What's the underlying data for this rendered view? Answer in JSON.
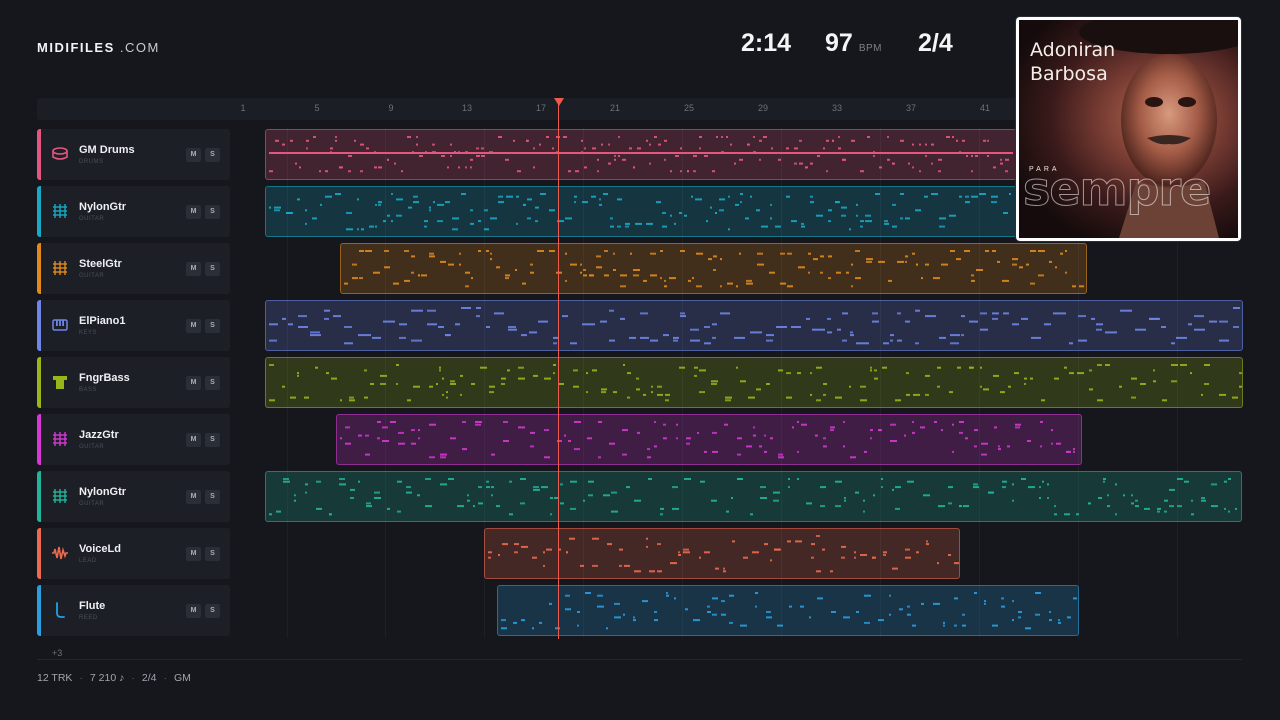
{
  "header": {
    "logo_bold": "MIDIFILES",
    "logo_suffix": " .COM",
    "time": "2:14",
    "bpm_value": "97",
    "bpm_label": "BPM",
    "time_signature": "2/4"
  },
  "ruler": {
    "ticks": [
      "1",
      "5",
      "9",
      "13",
      "17",
      "21",
      "25",
      "29",
      "33",
      "37",
      "41"
    ]
  },
  "tracks": [
    {
      "name": "GM Drums",
      "sub": "DRUMS",
      "color": "#e4567f",
      "icon": "drum-icon",
      "mute": "M",
      "solo": "S"
    },
    {
      "name": "NylonGtr",
      "sub": "GUITAR",
      "color": "#19a9c4",
      "icon": "guitar-grid-icon",
      "mute": "M",
      "solo": "S"
    },
    {
      "name": "SteelGtr",
      "sub": "GUITAR",
      "color": "#e08a1e",
      "icon": "guitar-grid-icon",
      "mute": "M",
      "solo": "S"
    },
    {
      "name": "ElPiano1",
      "sub": "KEYS",
      "color": "#6f86e8",
      "icon": "keys-icon",
      "mute": "M",
      "solo": "S"
    },
    {
      "name": "FngrBass",
      "sub": "BASS",
      "color": "#98b51a",
      "icon": "bass-icon",
      "mute": "M",
      "solo": "S"
    },
    {
      "name": "JazzGtr",
      "sub": "GUITAR",
      "color": "#d638d4",
      "icon": "guitar-grid-icon",
      "mute": "M",
      "solo": "S"
    },
    {
      "name": "NylonGtr",
      "sub": "GUITAR",
      "color": "#22b59b",
      "icon": "guitar-grid-icon",
      "mute": "M",
      "solo": "S"
    },
    {
      "name": "VoiceLd",
      "sub": "LEAD",
      "color": "#ee6a4f",
      "icon": "waveform-icon",
      "mute": "M",
      "solo": "S"
    },
    {
      "name": "Flute",
      "sub": "REED",
      "color": "#2a9fe0",
      "icon": "flute-icon",
      "mute": "M",
      "solo": "S"
    }
  ],
  "more_tracks": "+3",
  "footer": {
    "tracks": "12 TRK",
    "notes": "7 210 ♪",
    "signature": "2/4",
    "standard": "GM",
    "separator": "·"
  },
  "album": {
    "artist_line1": "Adoniran",
    "artist_line2": "Barbosa",
    "prefix": "PARA",
    "title": "sempre"
  }
}
